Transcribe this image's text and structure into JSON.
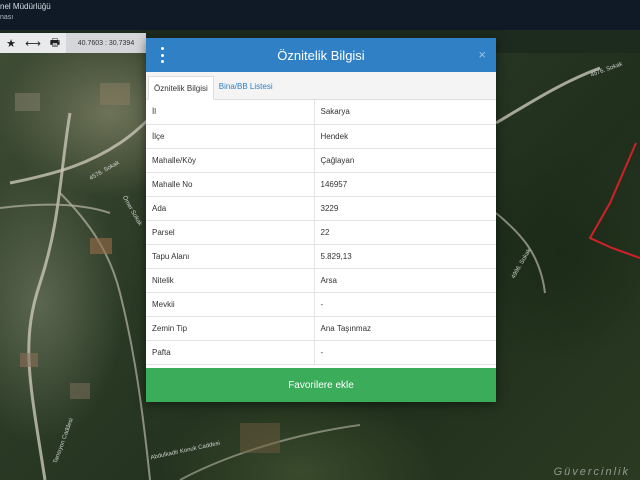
{
  "header": {
    "title_line1": "nel Müdürlüğü",
    "title_line2": "nası"
  },
  "toolbar": {
    "tools": [
      {
        "icon": "star-icon",
        "glyph": "★"
      },
      {
        "icon": "measure-icon",
        "glyph": "⟷"
      },
      {
        "icon": "print-icon",
        "glyph": "🖶"
      }
    ],
    "coordinates": "40.7603 : 30.7394"
  },
  "map": {
    "road_labels": [
      "4576. Sokak",
      "4996. Sokak",
      "4578. Sokak",
      "Ömer Sokak",
      "Abdulkadir Konuk Caddesi",
      "Tansıyon Caddesi"
    ],
    "watermark": "Güvercinlik",
    "parcel_outline_color": "#d0202a"
  },
  "modal": {
    "title": "Öznitelik Bilgisi",
    "close_label": "×",
    "tabs": [
      {
        "label": "Öznitelik Bilgisi",
        "active": true
      },
      {
        "label": "Bina/BB Listesi",
        "active": false
      }
    ],
    "rows": [
      {
        "key": "İl",
        "value": "Sakarya"
      },
      {
        "key": "İlçe",
        "value": "Hendek"
      },
      {
        "key": "Mahalle/Köy",
        "value": "Çağlayan"
      },
      {
        "key": "Mahalle No",
        "value": "146957"
      },
      {
        "key": "Ada",
        "value": "3229"
      },
      {
        "key": "Parsel",
        "value": "22"
      },
      {
        "key": "Tapu Alanı",
        "value": "5.829,13"
      },
      {
        "key": "Nitelik",
        "value": "Arsa"
      },
      {
        "key": "Mevkii",
        "value": "-"
      },
      {
        "key": "Zemin Tip",
        "value": "Ana Taşınmaz"
      },
      {
        "key": "Pafta",
        "value": "-"
      }
    ],
    "favorite_button": "Favorilere ekle",
    "header_color": "#2f80c5",
    "button_color": "#3bad5a"
  }
}
